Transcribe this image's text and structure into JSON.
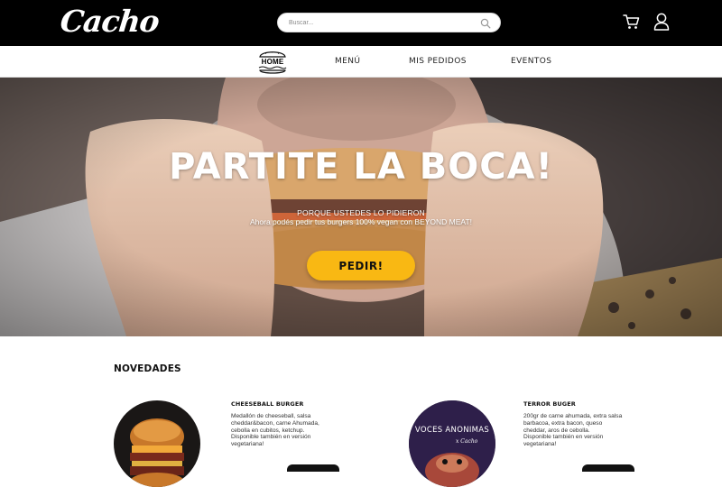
{
  "header": {
    "logo_text": "Cacho",
    "search_placeholder": "Buscar...",
    "icons": [
      "search-icon",
      "cart-icon",
      "user-icon"
    ]
  },
  "nav": {
    "home_label": "HOME",
    "items": [
      {
        "label": "MENÚ"
      },
      {
        "label": "MIS PEDIDOS"
      },
      {
        "label": "EVENTOS"
      }
    ]
  },
  "hero": {
    "title": "PARTITE LA BOCA!",
    "subtitle_line1": "PORQUE USTEDES LO PIDIERON",
    "subtitle_line2": "Ahora podés pedir tus burgers 100% vegan con BEYOND MEAT!",
    "button_label": "PEDIR!"
  },
  "novedades": {
    "title": "NOVEDADES",
    "items": [
      {
        "name": "CHEESEBALL BURGER",
        "description_lines": [
          "Medallón de cheeseball, salsa",
          "cheddar&bacon, carne Ahumada,",
          "cebolla en cubitos, ketchup.",
          "Disponible también en versión",
          "vegetariana!"
        ]
      },
      {
        "name": "TERROR BUGER",
        "image_text": "VOCES ANONIMAS",
        "image_subtext": "x Cacho",
        "description_lines": [
          "200gr de carne ahumada, extra salsa",
          "barbacoa, extra bacon, queso",
          "cheddar, aros de cebolla.",
          "Disponible también en versión",
          "vegetariana!"
        ]
      }
    ]
  },
  "colors": {
    "topbar": "#000000",
    "accent_button": "#f9b813",
    "text_dark": "#111111"
  }
}
